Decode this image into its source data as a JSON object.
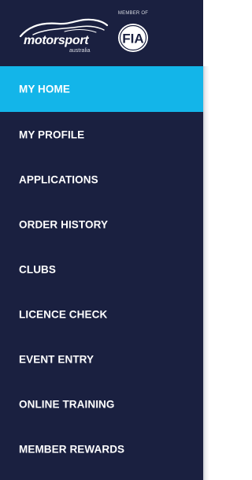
{
  "brand": {
    "logo_text": "motorsport",
    "logo_subtext": "australia",
    "fia_caption": "MEMBER OF",
    "fia_badge_text": "FIA"
  },
  "nav": {
    "active_index": 0,
    "items": [
      {
        "label": "MY HOME"
      },
      {
        "label": "MY PROFILE"
      },
      {
        "label": "APPLICATIONS"
      },
      {
        "label": "ORDER HISTORY"
      },
      {
        "label": "CLUBS"
      },
      {
        "label": "LICENCE CHECK"
      },
      {
        "label": "EVENT ENTRY"
      },
      {
        "label": "ONLINE TRAINING"
      },
      {
        "label": "MEMBER REWARDS"
      }
    ]
  },
  "colors": {
    "sidebar_bg": "#1a2040",
    "active_bg": "#13b5e9",
    "text": "#ffffff"
  }
}
